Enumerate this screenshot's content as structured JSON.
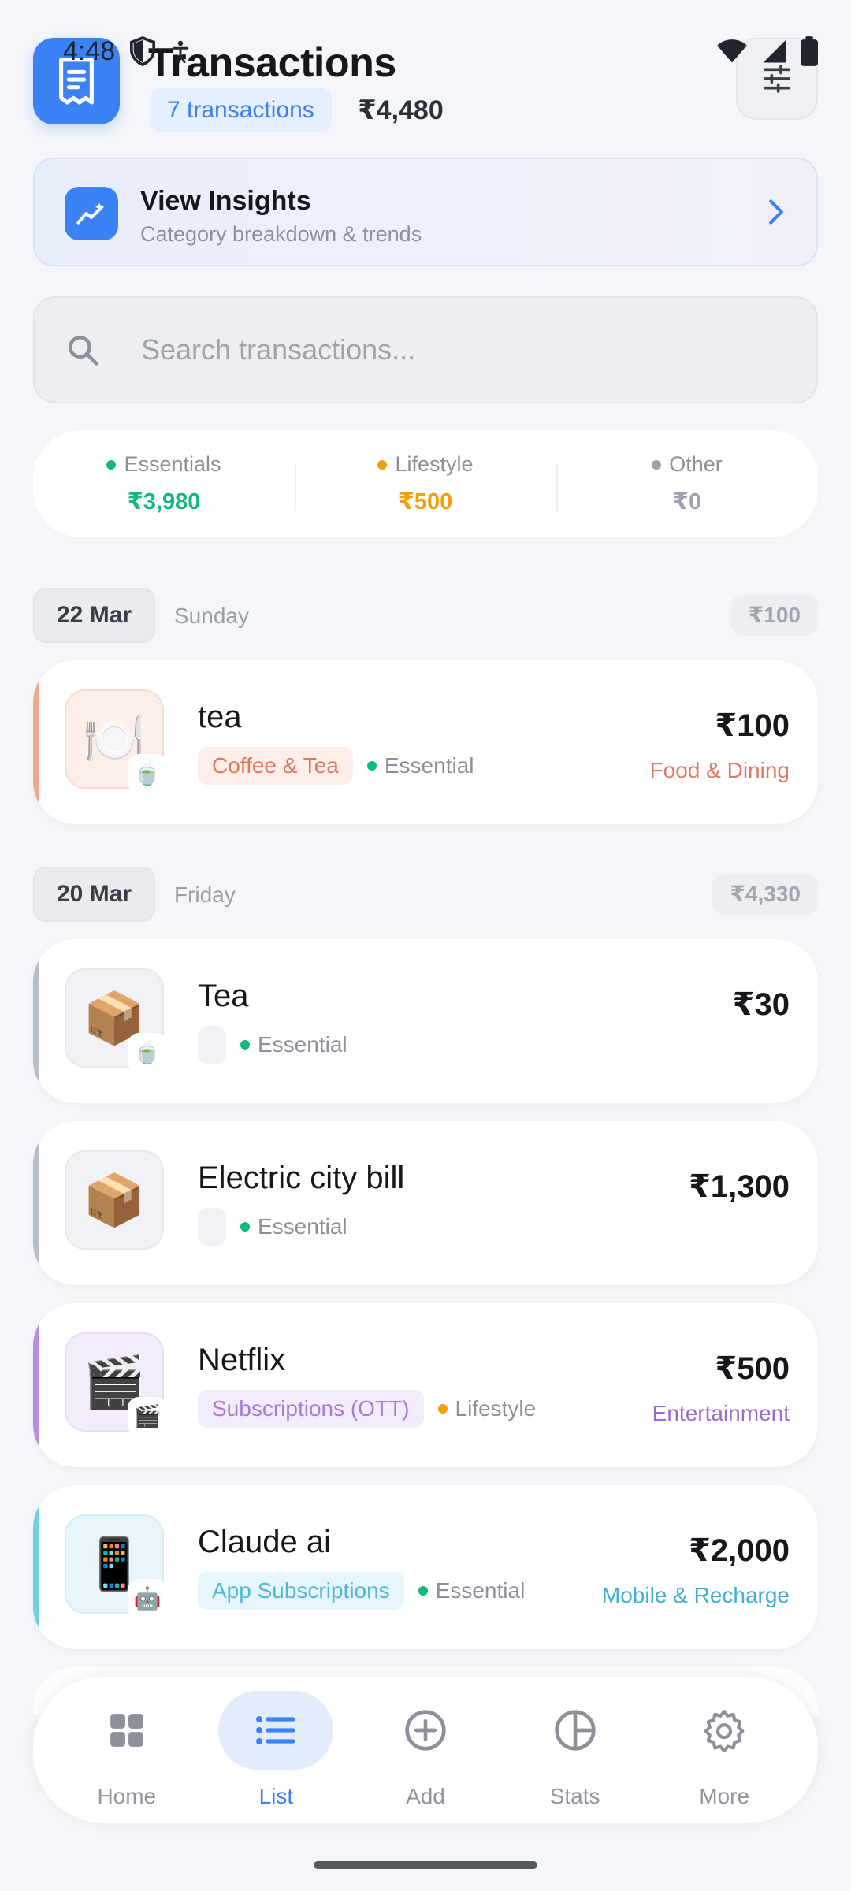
{
  "status_bar": {
    "time": "4:48"
  },
  "header": {
    "title": "Transactions",
    "count_label": "7 transactions",
    "total": "₹4,480"
  },
  "insights": {
    "title": "View Insights",
    "subtitle": "Category breakdown & trends"
  },
  "search": {
    "placeholder": "Search transactions..."
  },
  "summary": [
    {
      "label": "Essentials",
      "value": "₹3,980",
      "color": "#10b981"
    },
    {
      "label": "Lifestyle",
      "value": "₹500",
      "color": "#f59e0b"
    },
    {
      "label": "Other",
      "value": "₹0",
      "color": "#9ca3af"
    }
  ],
  "groups": [
    {
      "date": "22 Mar",
      "day": "Sunday",
      "total": "₹100",
      "transactions": [
        {
          "name": "tea",
          "tag": "Coffee & Tea",
          "priority": "Essential",
          "priority_color": "#10b981",
          "amount": "₹100",
          "category": "Food & Dining",
          "accent": "#f2a68c",
          "tag_bg": "#fdeeea",
          "tag_color": "#e07a5f",
          "cat_color": "#e07a5f",
          "icon_bg": "#fdeeea",
          "icon": "plate-icon",
          "sub_icon": "tea-icon"
        }
      ]
    },
    {
      "date": "20 Mar",
      "day": "Friday",
      "total": "₹4,330",
      "transactions": [
        {
          "name": "Tea",
          "tag": "",
          "priority": "Essential",
          "priority_color": "#10b981",
          "amount": "₹30",
          "category": "",
          "accent": "#b7bdcc",
          "icon_bg": "#f1f2f5",
          "icon": "package-icon",
          "sub_icon": "tea-icon"
        },
        {
          "name": "Electric city bill",
          "tag": "",
          "priority": "Essential",
          "priority_color": "#10b981",
          "amount": "₹1,300",
          "category": "",
          "accent": "#b7bdcc",
          "icon_bg": "#f1f2f5",
          "icon": "package-icon",
          "sub_icon": ""
        },
        {
          "name": "Netflix",
          "tag": "Subscriptions (OTT)",
          "priority": "Lifestyle",
          "priority_color": "#f59e0b",
          "amount": "₹500",
          "category": "Entertainment",
          "accent": "#b48ee0",
          "tag_bg": "#f3ecfb",
          "tag_color": "#a77bd8",
          "cat_color": "#9b6bd2",
          "icon_bg": "#f3ecfb",
          "icon": "clapper-icon",
          "sub_icon": "clapper-icon"
        },
        {
          "name": "Claude ai",
          "tag": "App Subscriptions",
          "priority": "Essential",
          "priority_color": "#10b981",
          "amount": "₹2,000",
          "category": "Mobile & Recharge",
          "accent": "#6fd0e6",
          "tag_bg": "#e6f6fa",
          "tag_color": "#4fb8d6",
          "cat_color": "#3fb0d4",
          "icon_bg": "#e6f6fa",
          "icon": "mobile-icon",
          "sub_icon": "robot-icon"
        }
      ]
    }
  ],
  "nav": [
    {
      "label": "Home",
      "icon": "grid-icon"
    },
    {
      "label": "List",
      "icon": "list-icon",
      "active": true
    },
    {
      "label": "Add",
      "icon": "plus-circle-icon"
    },
    {
      "label": "Stats",
      "icon": "pie-icon"
    },
    {
      "label": "More",
      "icon": "gear-icon"
    }
  ],
  "colors": {
    "accent": "#3b82f6",
    "essential": "#10b981",
    "lifestyle": "#f59e0b",
    "other": "#9ca3af"
  }
}
